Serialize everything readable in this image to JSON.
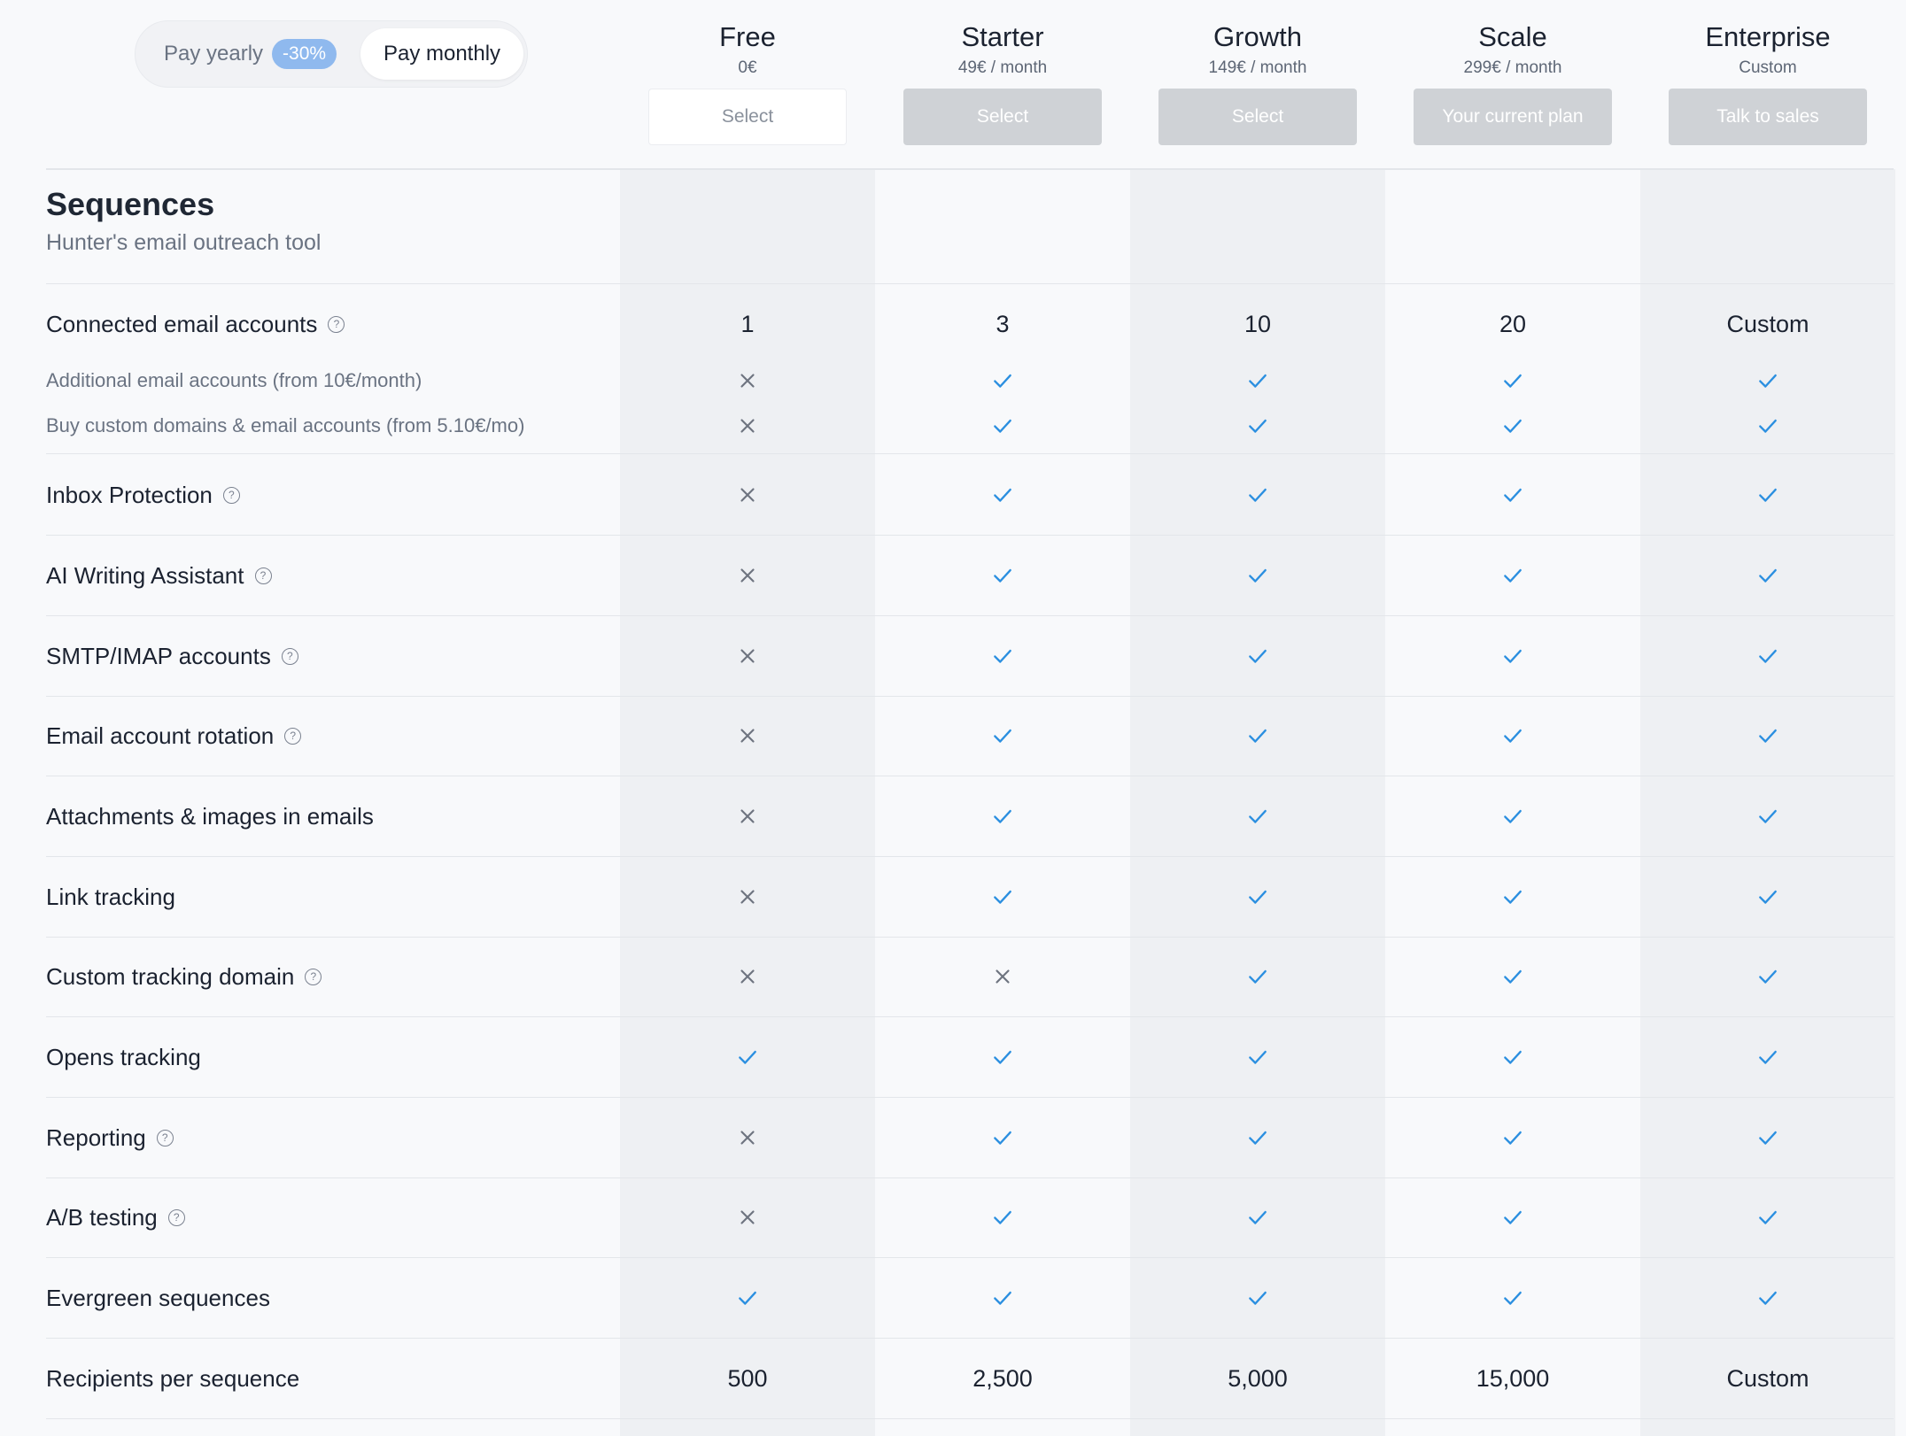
{
  "billing_toggle": {
    "yearly_label": "Pay yearly",
    "yearly_discount": "-30%",
    "monthly_label": "Pay monthly",
    "selected": "monthly"
  },
  "plans": [
    {
      "name": "Free",
      "price": "0€",
      "button": "Select"
    },
    {
      "name": "Starter",
      "price": "49€ / month",
      "button": "Select"
    },
    {
      "name": "Growth",
      "price": "149€ / month",
      "button": "Select"
    },
    {
      "name": "Scale",
      "price": "299€ / month",
      "button": "Your current plan"
    },
    {
      "name": "Enterprise",
      "price": "Custom",
      "button": "Talk to sales"
    }
  ],
  "section": {
    "title": "Sequences",
    "subtitle": "Hunter's email outreach tool"
  },
  "features": [
    {
      "label": "Connected email accounts",
      "help": true,
      "sub": false,
      "values": [
        "1",
        "3",
        "10",
        "20",
        "Custom"
      ]
    },
    {
      "label": "Additional email accounts (from 10€/month)",
      "help": false,
      "sub": true,
      "values": [
        "no",
        "yes",
        "yes",
        "yes",
        "yes"
      ]
    },
    {
      "label": "Buy custom domains & email accounts (from 5.10€/mo)",
      "help": false,
      "sub": true,
      "values": [
        "no",
        "yes",
        "yes",
        "yes",
        "yes"
      ]
    },
    {
      "label": "Inbox Protection",
      "help": true,
      "sub": false,
      "values": [
        "no",
        "yes",
        "yes",
        "yes",
        "yes"
      ]
    },
    {
      "label": "AI Writing Assistant",
      "help": true,
      "sub": false,
      "values": [
        "no",
        "yes",
        "yes",
        "yes",
        "yes"
      ]
    },
    {
      "label": "SMTP/IMAP accounts",
      "help": true,
      "sub": false,
      "values": [
        "no",
        "yes",
        "yes",
        "yes",
        "yes"
      ]
    },
    {
      "label": "Email account rotation",
      "help": true,
      "sub": false,
      "values": [
        "no",
        "yes",
        "yes",
        "yes",
        "yes"
      ]
    },
    {
      "label": "Attachments & images in emails",
      "help": false,
      "sub": false,
      "values": [
        "no",
        "yes",
        "yes",
        "yes",
        "yes"
      ]
    },
    {
      "label": "Link tracking",
      "help": false,
      "sub": false,
      "values": [
        "no",
        "yes",
        "yes",
        "yes",
        "yes"
      ]
    },
    {
      "label": "Custom tracking domain",
      "help": true,
      "sub": false,
      "values": [
        "no",
        "no",
        "yes",
        "yes",
        "yes"
      ]
    },
    {
      "label": "Opens tracking",
      "help": false,
      "sub": false,
      "values": [
        "yes",
        "yes",
        "yes",
        "yes",
        "yes"
      ]
    },
    {
      "label": "Reporting",
      "help": true,
      "sub": false,
      "values": [
        "no",
        "yes",
        "yes",
        "yes",
        "yes"
      ]
    },
    {
      "label": "A/B testing",
      "help": true,
      "sub": false,
      "values": [
        "no",
        "yes",
        "yes",
        "yes",
        "yes"
      ]
    },
    {
      "label": "Evergreen sequences",
      "help": false,
      "sub": false,
      "values": [
        "yes",
        "yes",
        "yes",
        "yes",
        "yes"
      ]
    },
    {
      "label": "Recipients per sequence",
      "help": false,
      "sub": false,
      "values": [
        "500",
        "2,500",
        "5,000",
        "15,000",
        "Custom"
      ]
    }
  ],
  "icons": {
    "check": "check-icon",
    "cross": "cross-icon",
    "help": "question-circle-icon"
  },
  "colors": {
    "check": "#2b8fe0",
    "cross": "#6e7480",
    "accent": "#8fb9ee"
  }
}
